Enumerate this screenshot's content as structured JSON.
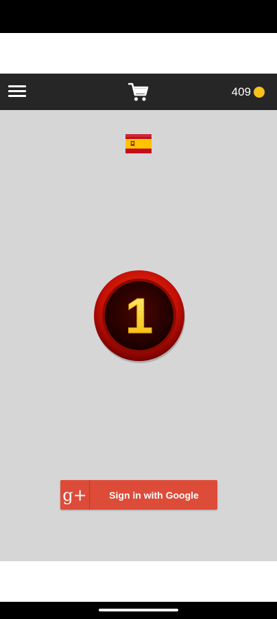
{
  "toolbar": {
    "menu_icon": "menu-icon",
    "cart_icon": "cart-icon",
    "coin_count": "409",
    "coin_icon": "coin-icon",
    "background_color": "#262626",
    "coin_color": "#f7c21b"
  },
  "main": {
    "language_flag": "spain-flag-icon",
    "level_number": "1",
    "background_color": "#d6d6d6"
  },
  "signin": {
    "icon_text": "g+",
    "label": "Sign in with Google",
    "color": "#dd4b39"
  }
}
